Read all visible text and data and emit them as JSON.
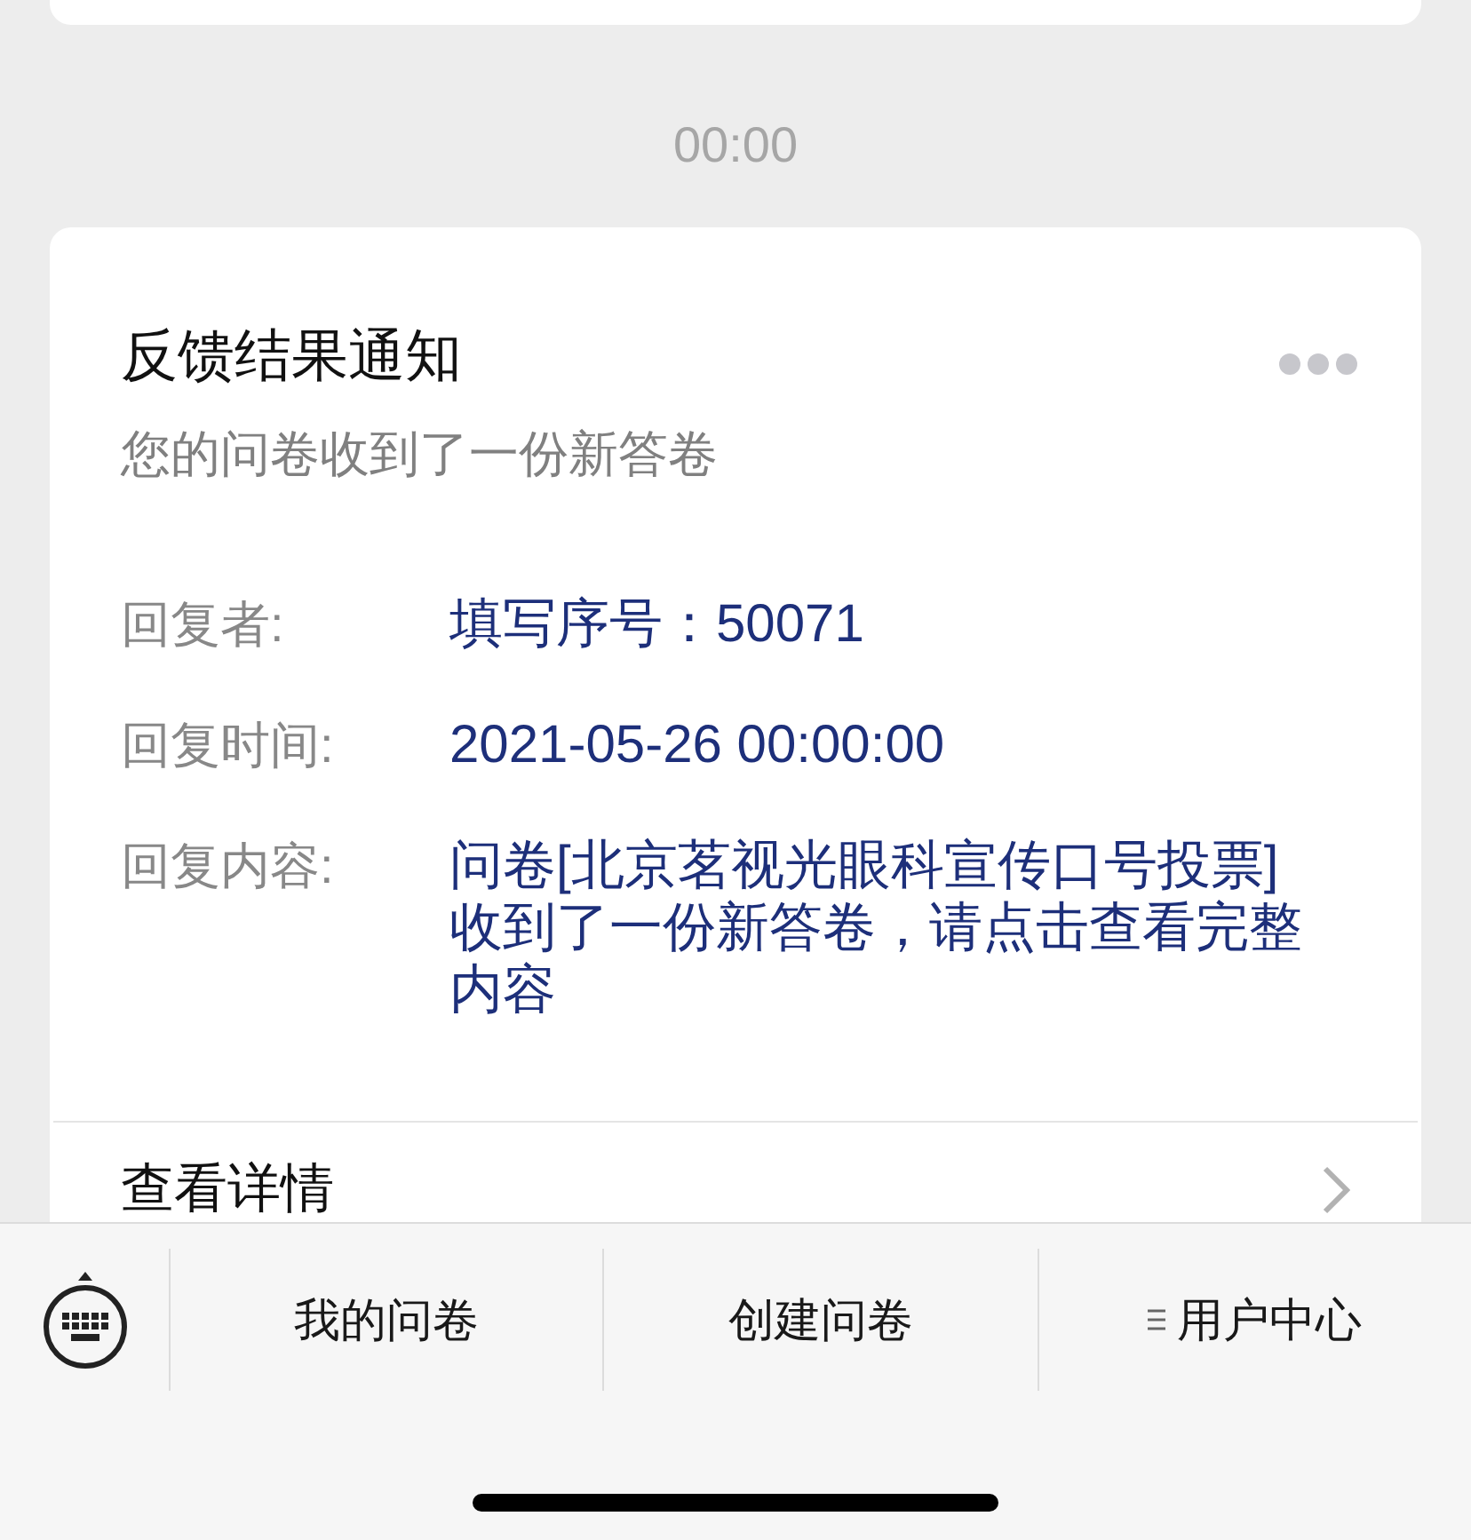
{
  "timestamp": "00:00",
  "card": {
    "title": "反馈结果通知",
    "subtitle": "您的问卷收到了一份新答卷",
    "fields": [
      {
        "label": "回复者:",
        "value": "填写序号：50071"
      },
      {
        "label": "回复时间:",
        "value": "2021-05-26 00:00:00"
      },
      {
        "label": "回复内容:",
        "value": "问卷[北京茗视光眼科宣传口号投票]收到了一份新答卷，请点击查看完整内容"
      }
    ],
    "link": "查看详情"
  },
  "menu": [
    {
      "label": "我的问卷",
      "has_submenu": false
    },
    {
      "label": "创建问卷",
      "has_submenu": false
    },
    {
      "label": "用户中心",
      "has_submenu": true
    }
  ]
}
